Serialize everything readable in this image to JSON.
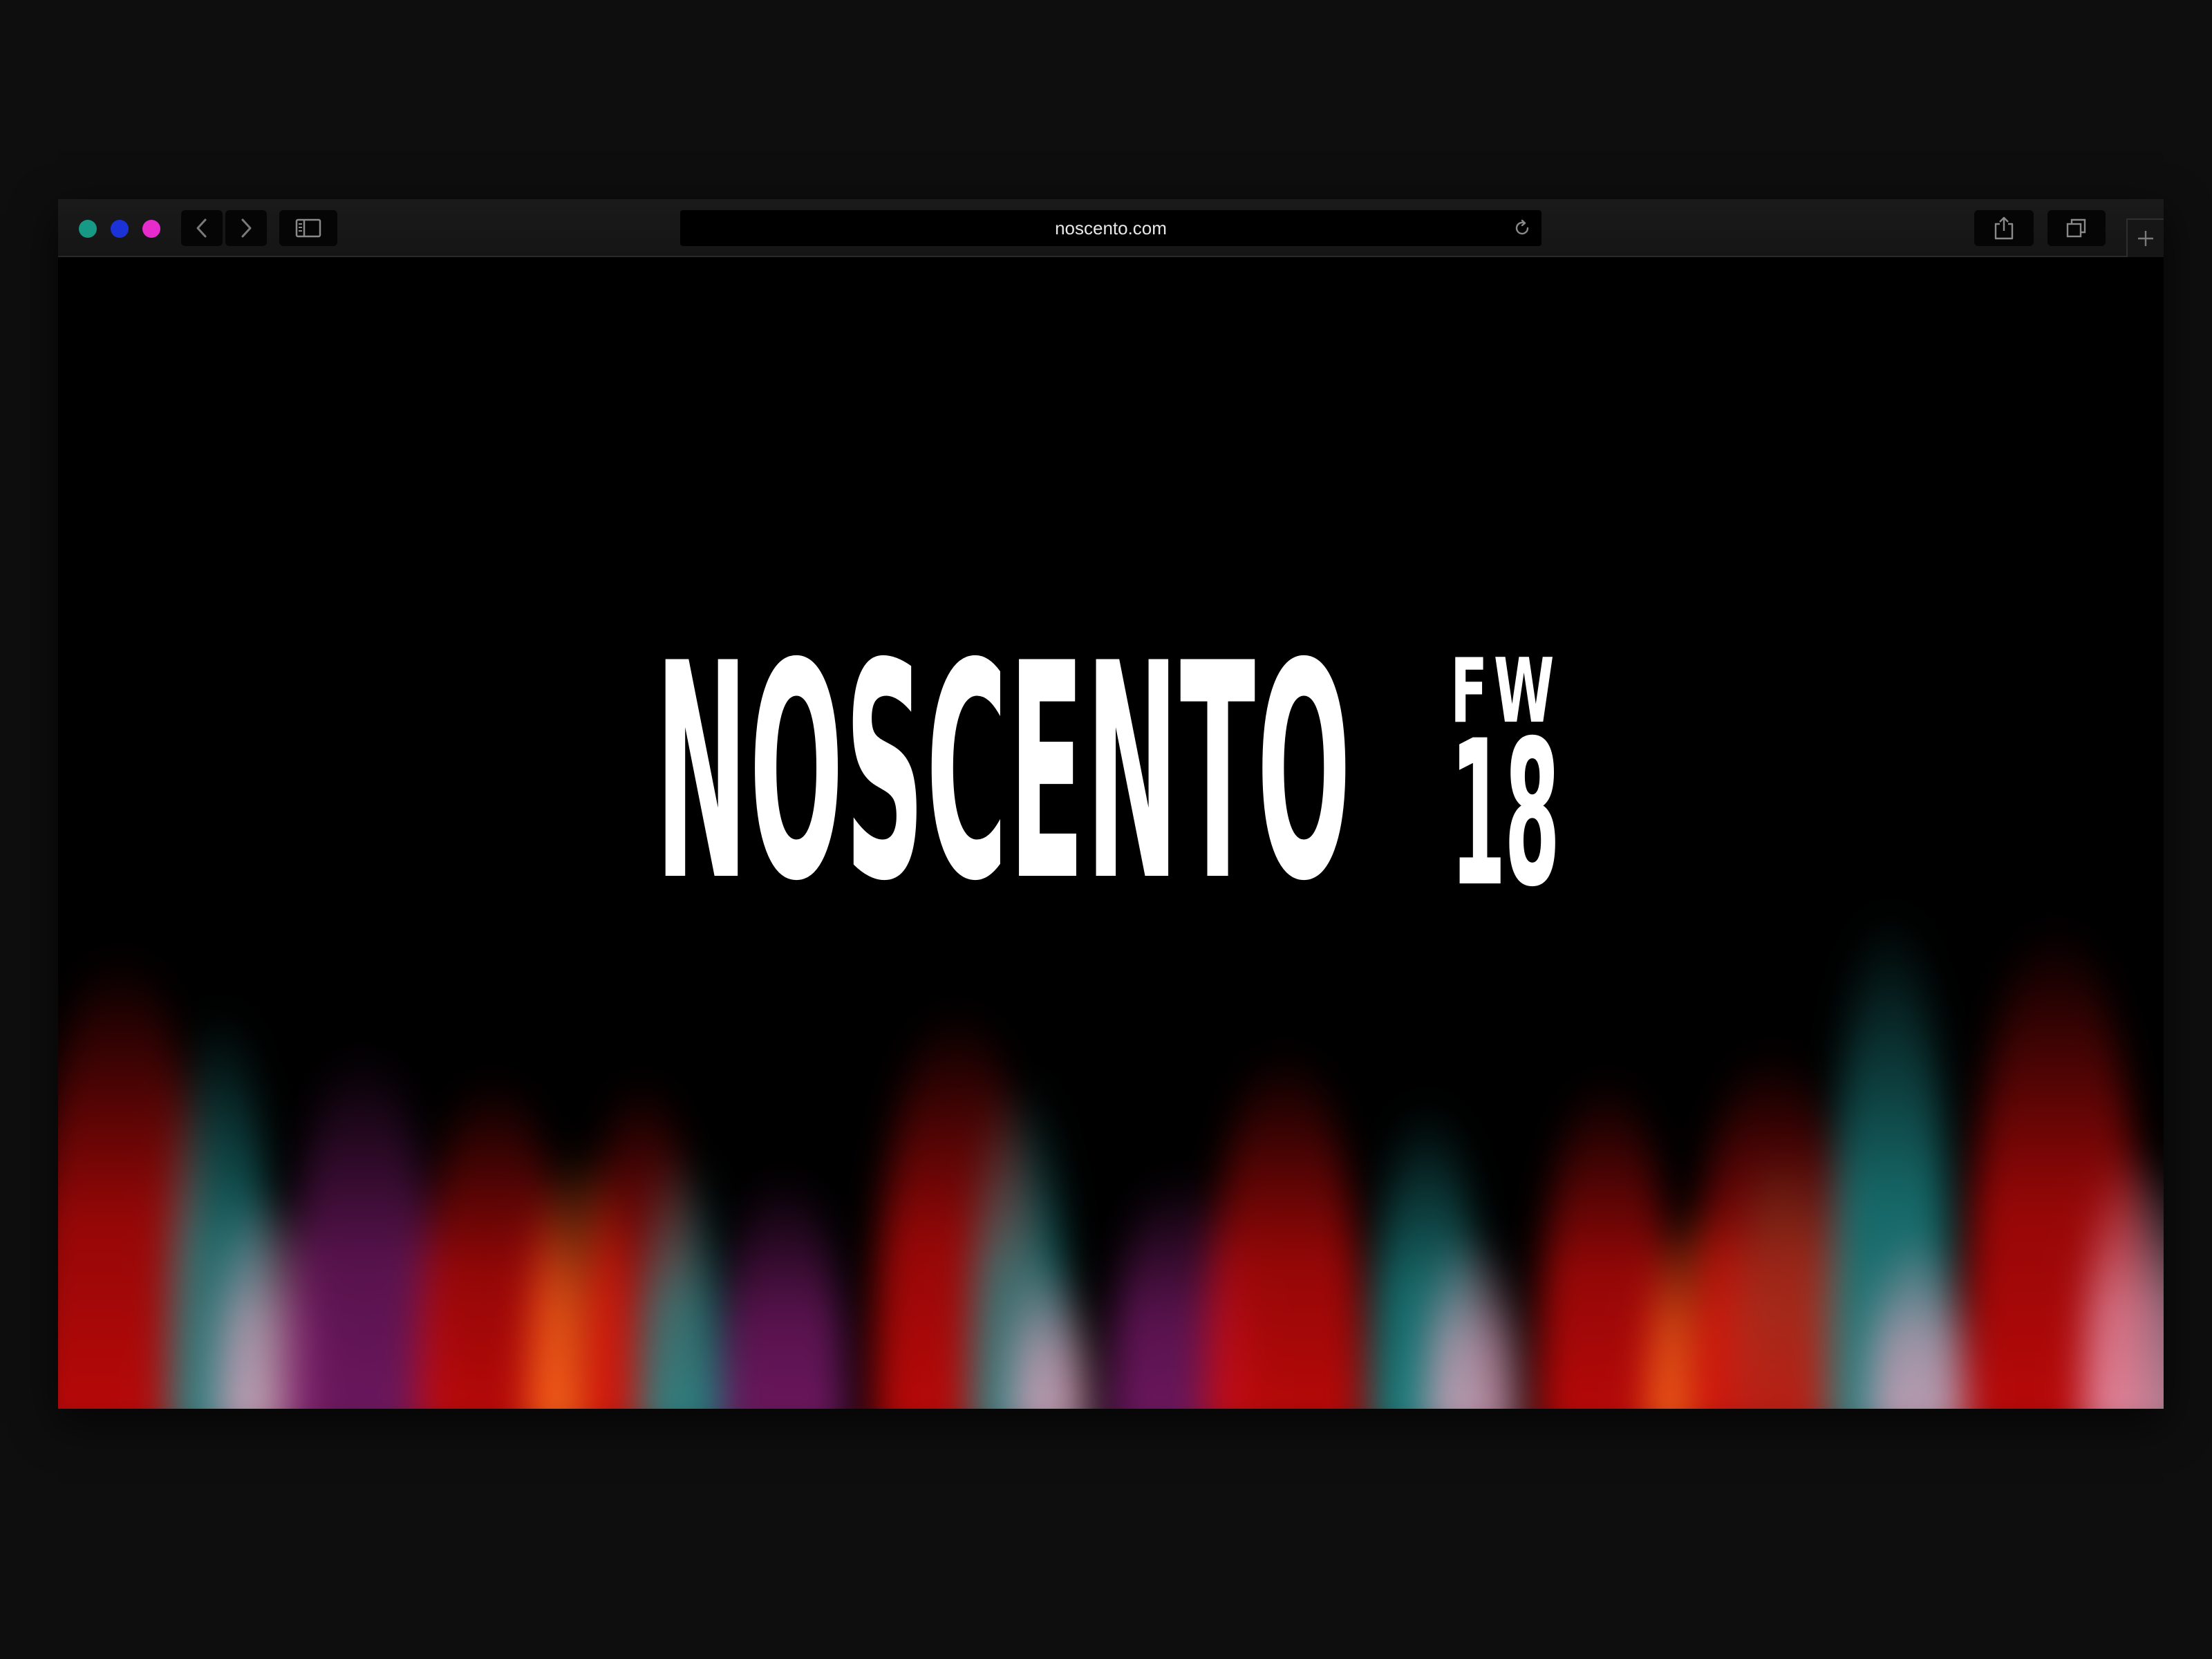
{
  "browser": {
    "url": "noscento.com",
    "traffic_lights": [
      {
        "name": "close",
        "color": "#169a86"
      },
      {
        "name": "minimize",
        "color": "#1b33d6"
      },
      {
        "name": "zoom",
        "color": "#e82ccb"
      }
    ],
    "toolbar_icons": {
      "back": "chevron-left-icon",
      "forward": "chevron-right-icon",
      "sidebar": "sidebar-icon",
      "reload": "reload-icon",
      "share": "share-icon",
      "tabs": "tabs-icon",
      "new_tab": "plus-icon"
    }
  },
  "page": {
    "brand": "NOSCENTO",
    "season_letters": "FW",
    "season_year": "18",
    "background_color": "#000000",
    "flame_colors": [
      "#d00a0a",
      "#1f8f8f",
      "#e9a4c0",
      "#7a1a6b",
      "#ff6a1a",
      "#19c46a"
    ]
  }
}
